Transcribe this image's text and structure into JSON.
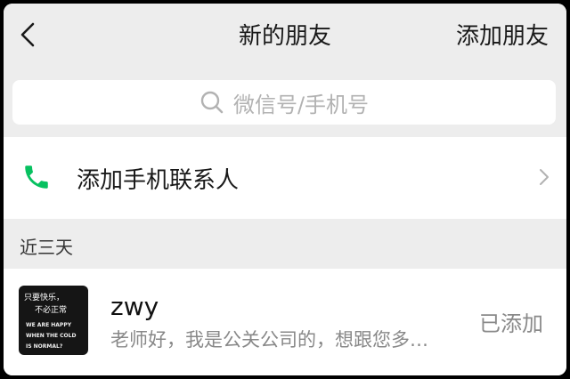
{
  "nav": {
    "title": "新的朋友",
    "action_label": "添加朋友"
  },
  "search": {
    "placeholder": "微信号/手机号"
  },
  "phone_contacts": {
    "label": "添加手机联系人",
    "icon": "phone-icon",
    "icon_color": "#07c160"
  },
  "section": {
    "header": "近三天"
  },
  "friends": [
    {
      "name": "zwy",
      "message": "老师好，我是公关公司的，想跟您多…",
      "status": "已添加",
      "avatar_lines": [
        "只要快乐，",
        "不必正常",
        "WE ARE HAPPY",
        "WHEN THE COLD",
        "IS NORMAL?"
      ]
    }
  ],
  "colors": {
    "background": "#ededed",
    "surface": "#ffffff",
    "text_primary": "#191919",
    "text_secondary": "#888888",
    "accent": "#07c160"
  }
}
